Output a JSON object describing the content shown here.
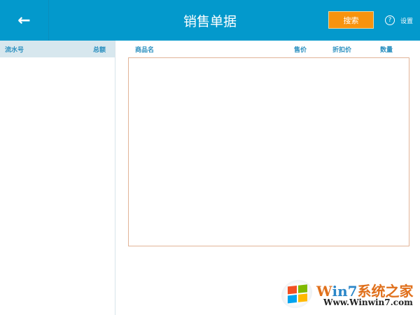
{
  "header": {
    "back_icon": "arrow-left-icon",
    "title": "销售单据",
    "search_label": "搜索",
    "help_icon": "?",
    "settings_label": "设置"
  },
  "left_panel": {
    "columns": [
      "流水号",
      "总额"
    ]
  },
  "table": {
    "columns": [
      "商品名",
      "售价",
      "折扣价",
      "数量"
    ],
    "rows": []
  },
  "watermark": {
    "brand": "Win7系统之家",
    "url": "Www.Winwin7.com"
  },
  "colors": {
    "header": "#0399cc",
    "accent": "#f7930e"
  }
}
